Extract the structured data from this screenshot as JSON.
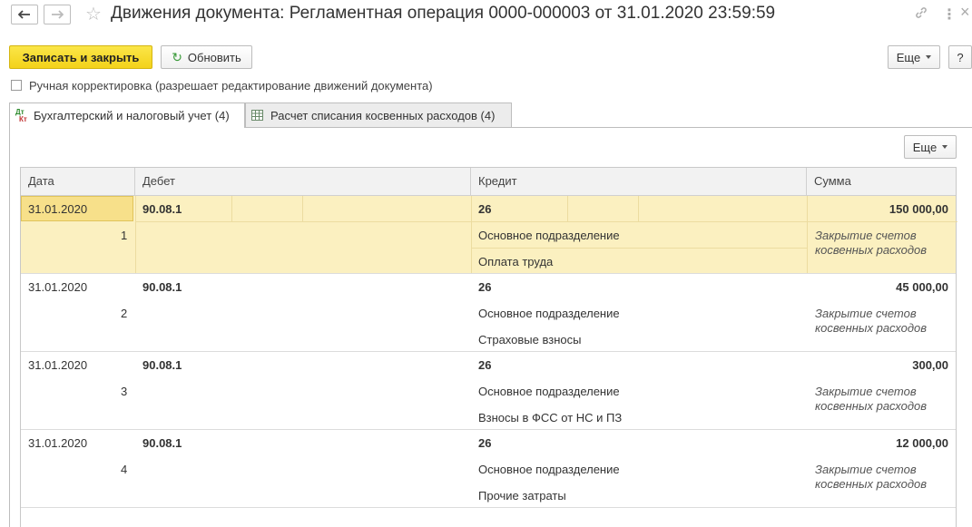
{
  "window": {
    "title": "Движения документа: Регламентная операция 0000-000003 от 31.01.2020 23:59:59",
    "icons": [
      "back-arrow-icon",
      "forward-arrow-icon",
      "star-icon",
      "link-icon",
      "more-vertical-icon",
      "close-icon"
    ]
  },
  "toolbar": {
    "save_close_label": "Записать и закрыть",
    "refresh_label": "Обновить",
    "more_label": "Еще",
    "help_label": "?"
  },
  "manual_edit": {
    "label": "Ручная корректировка (разрешает редактирование движений документа)",
    "checked": false
  },
  "tabs": [
    {
      "label": "Бухгалтерский и налоговый учет (4)",
      "icon": "dt-kt-icon",
      "active": true
    },
    {
      "label": "Расчет списания косвенных расходов (4)",
      "icon": "table-icon",
      "active": false
    }
  ],
  "table": {
    "more_label": "Еще",
    "columns": [
      "Дата",
      "Дебет",
      "Кредит",
      "Сумма"
    ],
    "rows": [
      {
        "date": "31.01.2020",
        "num": "1",
        "debit": "90.08.1",
        "credit": "26",
        "sub1": "Основное подразделение",
        "sub2": "Оплата труда",
        "sum": "150 000,00",
        "desc": "Закрытие счетов косвенных расходов"
      },
      {
        "date": "31.01.2020",
        "num": "2",
        "debit": "90.08.1",
        "credit": "26",
        "sub1": "Основное подразделение",
        "sub2": "Страховые взносы",
        "sum": "45 000,00",
        "desc": "Закрытие счетов косвенных расходов"
      },
      {
        "date": "31.01.2020",
        "num": "3",
        "debit": "90.08.1",
        "credit": "26",
        "sub1": "Основное подразделение",
        "sub2": "Взносы в ФСС от НС и ПЗ",
        "sum": "300,00",
        "desc": "Закрытие счетов косвенных расходов"
      },
      {
        "date": "31.01.2020",
        "num": "4",
        "debit": "90.08.1",
        "credit": "26",
        "sub1": "Основное подразделение",
        "sub2": "Прочие затраты",
        "sum": "12 000,00",
        "desc": "Закрытие счетов косвенных расходов"
      }
    ]
  },
  "colors": {
    "primary_button": "#f3d21a",
    "selected_row": "#fbf0c0"
  }
}
